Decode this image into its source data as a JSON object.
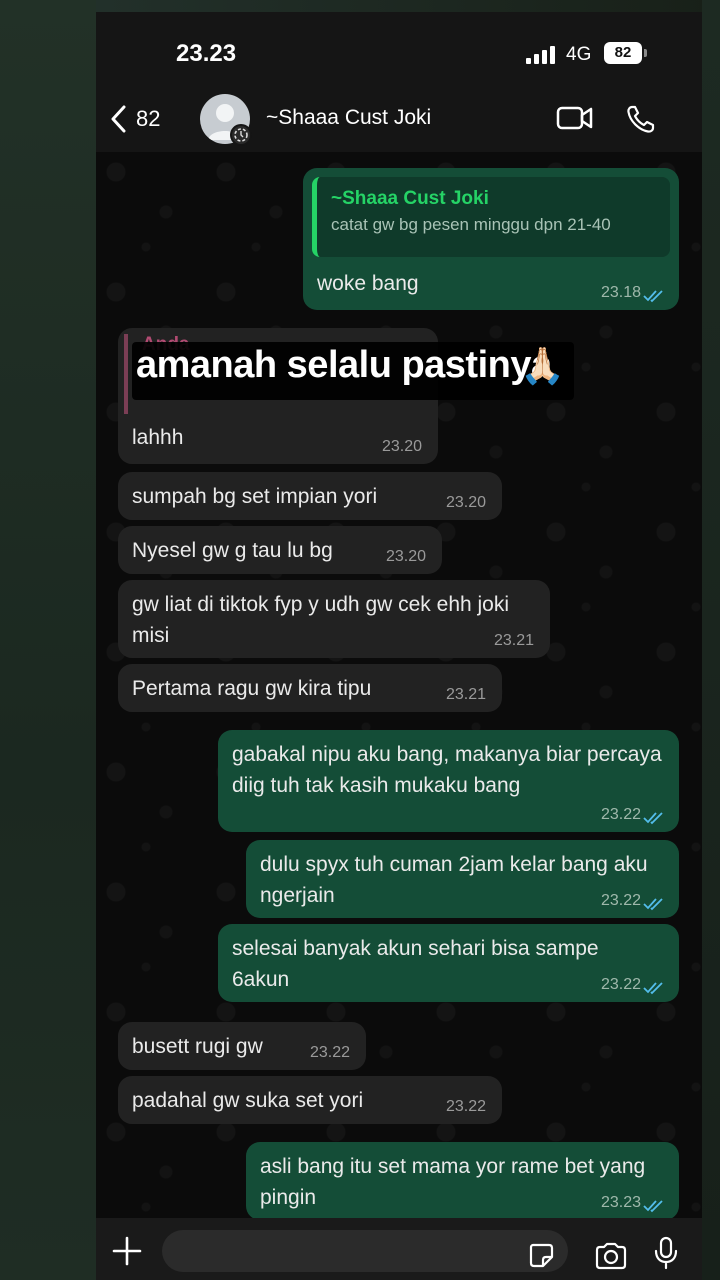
{
  "status_bar": {
    "time": "23.23",
    "network": "4G",
    "battery": "82"
  },
  "header": {
    "back_count": "82",
    "contact_name": "~Shaaa Cust Joki"
  },
  "caption": {
    "quoted_author": "Anda",
    "text": "amanah selalu pastinya",
    "emoji": "🙏🏻"
  },
  "messages": [
    {
      "dir": "out",
      "quote_author": "~Shaaa Cust Joki",
      "quote_text": "catat gw bg pesen minggu dpn 21-40",
      "text": "woke bang",
      "time": "23.18",
      "read": true
    },
    {
      "dir": "in",
      "text": "lahhh",
      "time": "23.20"
    },
    {
      "dir": "in",
      "text": "sumpah bg set impian yori",
      "time": "23.20"
    },
    {
      "dir": "in",
      "text": "Nyesel gw g tau lu bg",
      "time": "23.20"
    },
    {
      "dir": "in",
      "text": "gw liat di tiktok fyp y udh gw cek ehh joki misi",
      "time": "23.21"
    },
    {
      "dir": "in",
      "text": "Pertama ragu gw kira tipu",
      "time": "23.21"
    },
    {
      "dir": "out",
      "text": "gabakal nipu aku bang, makanya biar percaya diig tuh tak kasih mukaku bang",
      "time": "23.22",
      "read": true
    },
    {
      "dir": "out",
      "text": "dulu spyx tuh cuman 2jam kelar bang aku ngerjain",
      "time": "23.22",
      "read": true
    },
    {
      "dir": "out",
      "text": "selesai banyak akun sehari bisa sampe 6akun",
      "time": "23.22",
      "read": true
    },
    {
      "dir": "in",
      "text": "busett rugi gw",
      "time": "23.22"
    },
    {
      "dir": "in",
      "text": "padahal gw suka set yori",
      "time": "23.22"
    },
    {
      "dir": "out",
      "text": "asli bang itu set mama yor rame bet yang pingin",
      "time": "23.23",
      "read": true
    }
  ],
  "colors": {
    "outgoing": "#144d37",
    "incoming": "#222222",
    "accent": "#25d366",
    "read_tick": "#53bdeb"
  },
  "icons": [
    "back-chevron-icon",
    "video-call-icon",
    "phone-icon",
    "plus-icon",
    "sticker-icon",
    "camera-icon",
    "mic-icon"
  ]
}
